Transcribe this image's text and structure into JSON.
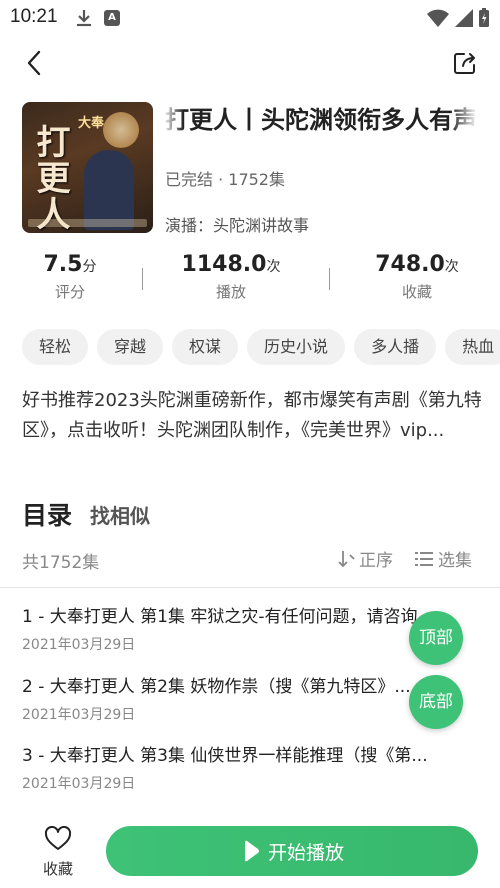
{
  "status_bar": {
    "time": "10:21",
    "a_badge": "A"
  },
  "book": {
    "title": "打更人丨头陀渊领衔多人有声剧丨都市爆笑",
    "status": "已完结 · 1752集",
    "narrator": "演播：头陀渊讲故事",
    "cover": {
      "tag": "大奉",
      "title": "打更人"
    }
  },
  "stats": [
    {
      "value": "7.5",
      "unit": "分",
      "label": "评分"
    },
    {
      "value": "1148.0",
      "unit": "次",
      "label": "播放"
    },
    {
      "value": "748.0",
      "unit": "次",
      "label": "收藏"
    }
  ],
  "tags": [
    "轻松",
    "穿越",
    "权谋",
    "历史小说",
    "多人播",
    "热血"
  ],
  "description": "好书推荐2023头陀渊重磅新作，都市爆笑有声剧《第九特区》，点击收听！头陀渊团队制作，《完美世界》vip...",
  "toc": {
    "title": "目录",
    "similar": "找相似",
    "count": "共1752集",
    "sort": "正序",
    "select": "选集"
  },
  "episodes": [
    {
      "title": "1 - 大奉打更人 第1集 牢狱之灾-有任何问题，请咨询",
      "date": "2021年03月29日"
    },
    {
      "title": "2 - 大奉打更人 第2集 妖物作祟（搜《第九特区》...",
      "date": "2021年03月29日"
    },
    {
      "title": "3 - 大奉打更人 第3集 仙侠世界一样能推理（搜《第...",
      "date": "2021年03月29日"
    }
  ],
  "float_buttons": {
    "top": "顶部",
    "bottom": "底部"
  },
  "bottom_bar": {
    "favorite": "收藏",
    "play": "开始播放"
  },
  "colors": {
    "accent": "#3ec277"
  }
}
